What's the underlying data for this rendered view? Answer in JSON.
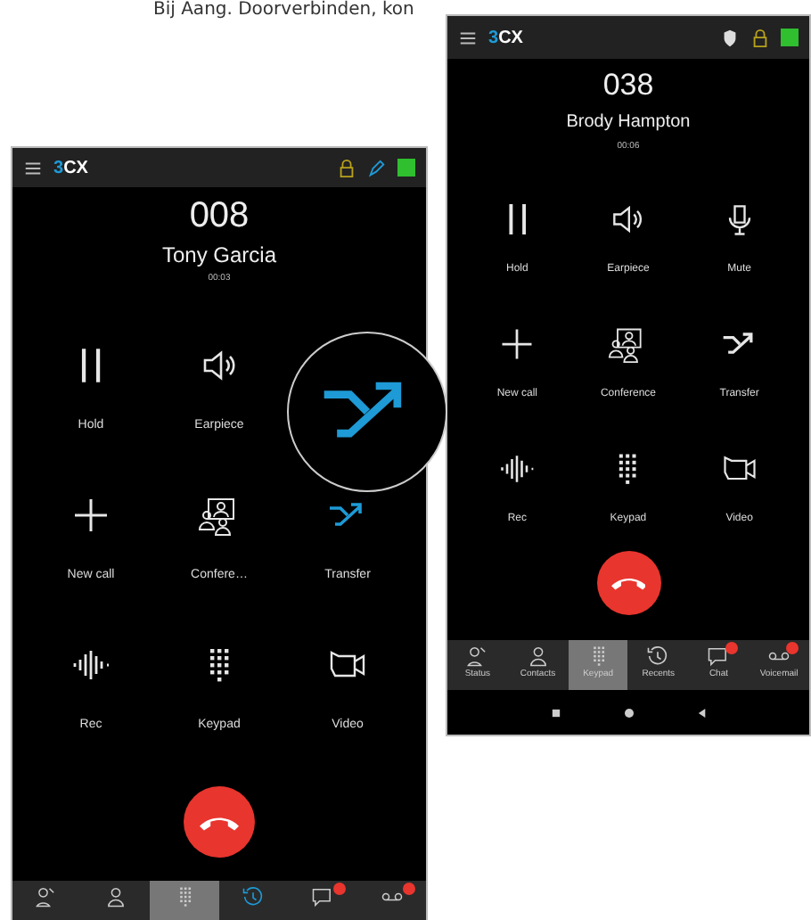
{
  "caption": "Bij Aang. Doorverbinden, kon",
  "phones": [
    {
      "logo": [
        "3",
        "CX"
      ],
      "indicators": [
        {
          "kind": "lock"
        },
        {
          "kind": "pen"
        },
        {
          "kind": "presence"
        }
      ],
      "number": "008",
      "name": "Tony Garcia",
      "duration": "00:03",
      "actions": [
        {
          "kind": "hold",
          "label": "Hold",
          "selected": false
        },
        {
          "kind": "earpiece",
          "label": "Earpiece",
          "selected": false
        },
        {
          "kind": "empty"
        },
        {
          "kind": "new_call",
          "label": "New call",
          "selected": false
        },
        {
          "kind": "conference",
          "label": "Confere…",
          "selected": false
        },
        {
          "kind": "transfer",
          "label": "Transfer",
          "selected": true
        },
        {
          "kind": "rec",
          "label": "Rec",
          "selected": false
        },
        {
          "kind": "keypad",
          "label": "Keypad",
          "selected": false
        },
        {
          "kind": "video",
          "label": "Video",
          "selected": false
        }
      ],
      "tabs": [
        {
          "kind": "status",
          "selected": false,
          "active": false,
          "badge": false
        },
        {
          "kind": "contacts",
          "selected": false,
          "active": false,
          "badge": false
        },
        {
          "kind": "keypad",
          "selected": true,
          "active": false,
          "badge": false
        },
        {
          "kind": "recents",
          "selected": false,
          "active": true,
          "badge": false
        },
        {
          "kind": "chat",
          "selected": false,
          "active": false,
          "badge": true
        },
        {
          "kind": "voicemail",
          "selected": false,
          "active": false,
          "badge": true
        }
      ]
    },
    {
      "logo": [
        "3",
        "CX"
      ],
      "indicators": [
        {
          "kind": "shield"
        },
        {
          "kind": "lock"
        },
        {
          "kind": "presence"
        }
      ],
      "number": "038",
      "name": "Brody Hampton",
      "duration": "00:06",
      "actions": [
        {
          "kind": "hold",
          "label": "Hold",
          "selected": false
        },
        {
          "kind": "earpiece",
          "label": "Earpiece",
          "selected": false
        },
        {
          "kind": "mute",
          "label": "Mute",
          "selected": false
        },
        {
          "kind": "new_call",
          "label": "New call",
          "selected": false
        },
        {
          "kind": "conference",
          "label": "Conference",
          "selected": false
        },
        {
          "kind": "transfer",
          "label": "Transfer",
          "selected": false
        },
        {
          "kind": "rec",
          "label": "Rec",
          "selected": false
        },
        {
          "kind": "keypad",
          "label": "Keypad",
          "selected": false
        },
        {
          "kind": "video",
          "label": "Video",
          "selected": false
        }
      ],
      "tabs": [
        {
          "kind": "status",
          "label": "Status",
          "selected": false,
          "active": false,
          "badge": false
        },
        {
          "kind": "contacts",
          "label": "Contacts",
          "selected": false,
          "active": false,
          "badge": false
        },
        {
          "kind": "keypad",
          "label": "Keypad",
          "selected": true,
          "active": false,
          "badge": false
        },
        {
          "kind": "recents",
          "label": "Recents",
          "selected": false,
          "active": false,
          "badge": false
        },
        {
          "kind": "chat",
          "label": "Chat",
          "selected": false,
          "active": false,
          "badge": true
        },
        {
          "kind": "voicemail",
          "label": "Voicemail",
          "selected": false,
          "active": false,
          "badge": true
        }
      ],
      "system_nav": [
        {
          "kind": "recents"
        },
        {
          "kind": "home"
        },
        {
          "kind": "back"
        }
      ]
    }
  ],
  "magnifier": {
    "kind": "transfer"
  }
}
